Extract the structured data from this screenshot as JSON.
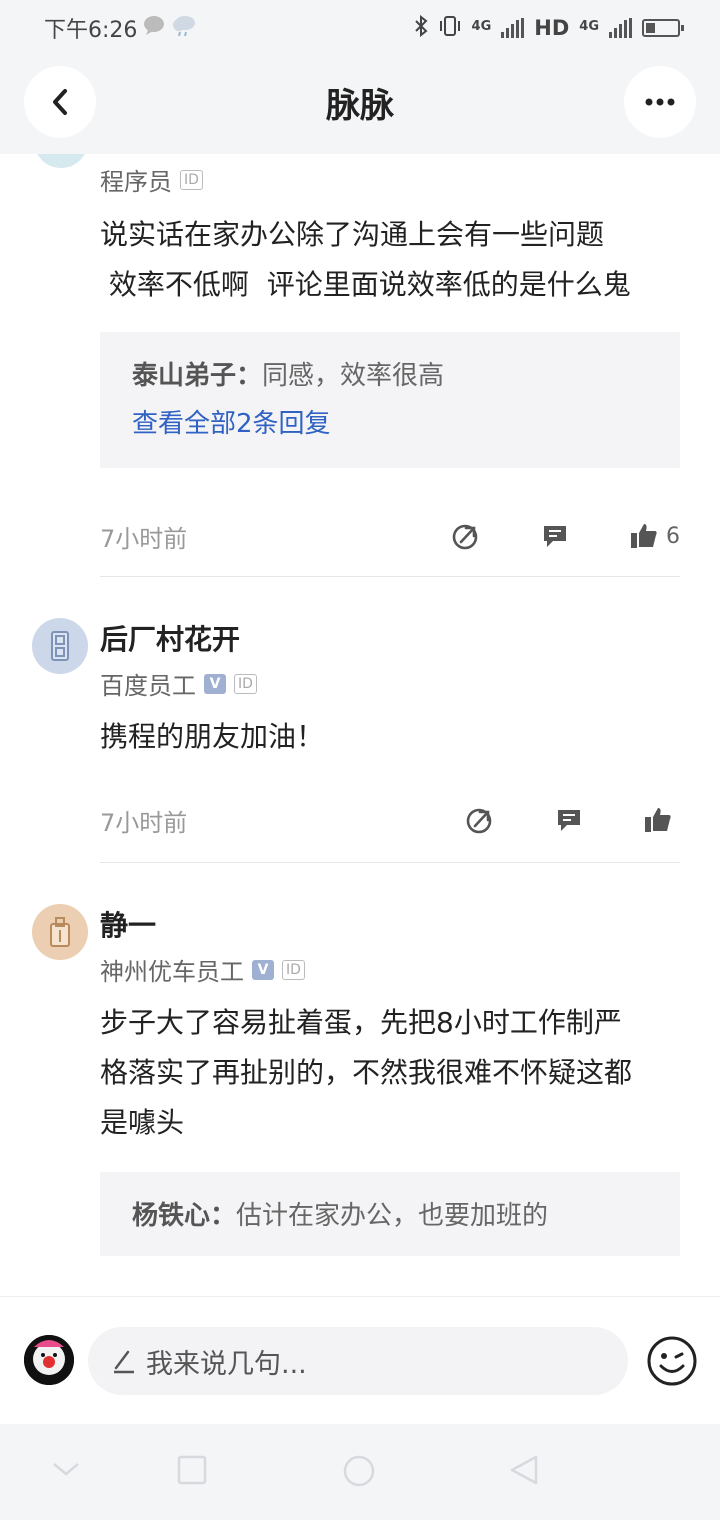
{
  "status_bar": {
    "time": "下午6:26",
    "network": "4G",
    "hd_label": "HD",
    "battery_percent": 30
  },
  "header": {
    "title": "脉脉"
  },
  "comments": [
    {
      "role": "程序员",
      "text_lines": [
        "说实话在家办公除了沟通上会有一些问题",
        " 效率不低啊  评论里面说效率低的是什么鬼"
      ],
      "reply": {
        "name": "泰山弟子：",
        "text": "同感，效率很高",
        "view_all": "查看全部2条回复"
      },
      "time": "7小时前",
      "like_count": "6"
    },
    {
      "name": "后厂村花开",
      "role": "百度员工",
      "text": "携程的朋友加油！",
      "time": "7小时前"
    },
    {
      "name": "静一",
      "role": "神州优车员工",
      "text_lines": [
        "步子大了容易扯着蛋，先把8小时工作制严",
        "格落实了再扯别的，不然我很难不怀疑这都",
        "是噱头"
      ],
      "reply": {
        "name": "杨铁心：",
        "text": "估计在家办公，也要加班的"
      }
    }
  ],
  "tags": {
    "id": "ID",
    "verified": "V"
  },
  "input": {
    "placeholder": "我来说几句..."
  },
  "icons": [
    "back-icon",
    "more-icon",
    "share-icon",
    "comment-icon",
    "like-icon",
    "pencil-icon",
    "emoji-icon"
  ],
  "colors": {
    "link": "#2f62c3",
    "verified": "#9fb0d2"
  }
}
